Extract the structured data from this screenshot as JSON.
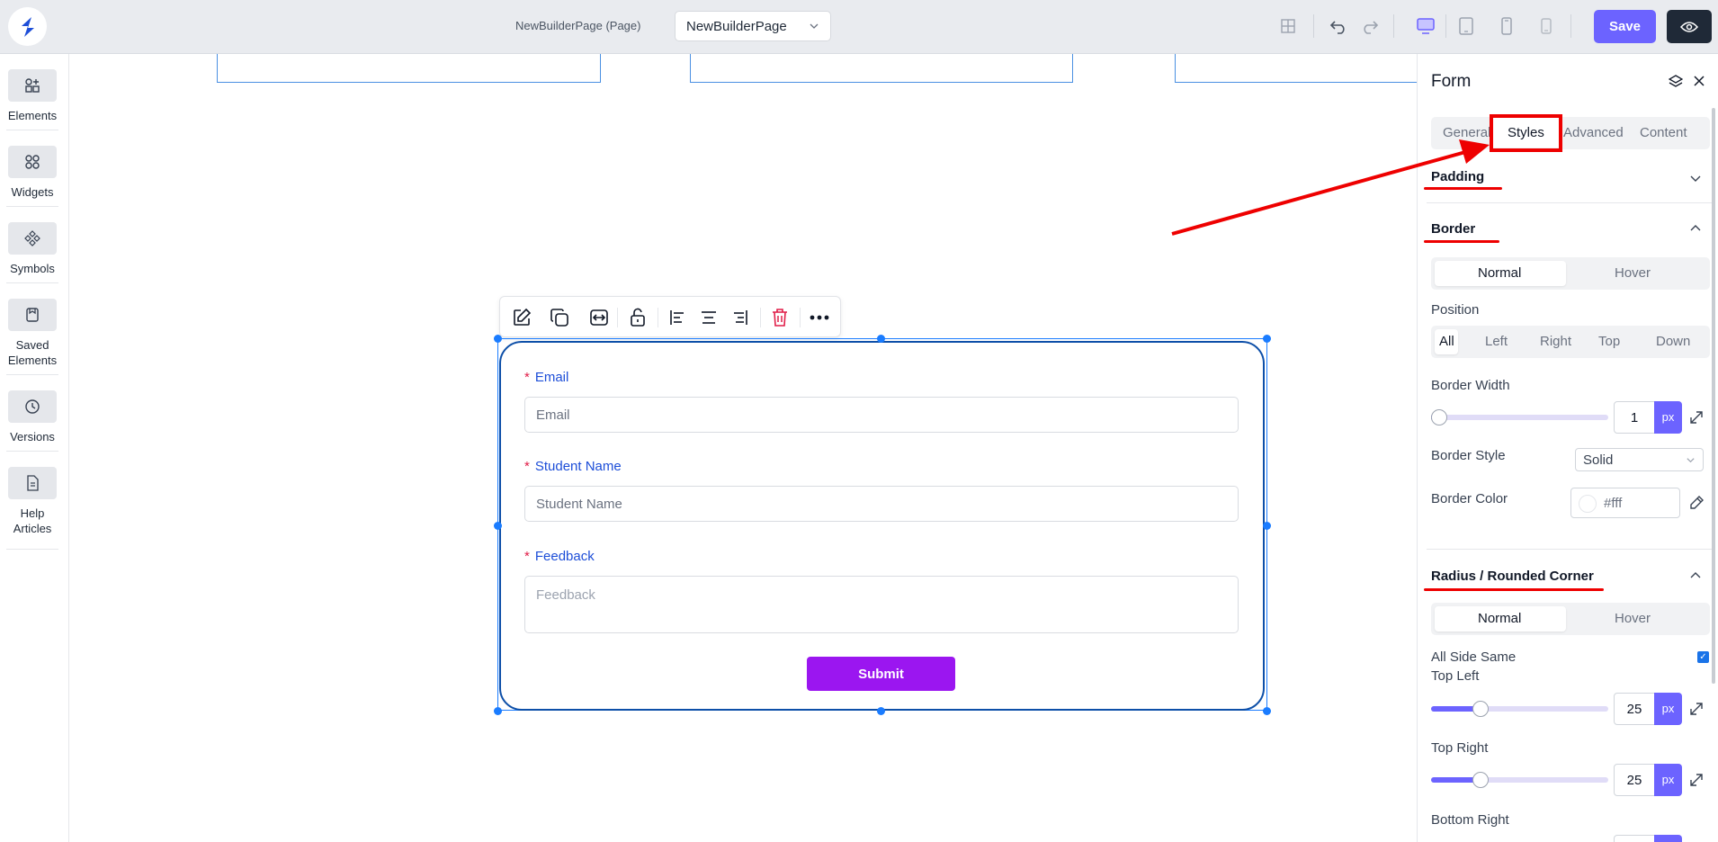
{
  "topbar": {
    "page_label": "NewBuilderPage (Page)",
    "page_select_value": "NewBuilderPage",
    "save_label": "Save"
  },
  "sidebar": {
    "items": [
      {
        "label": "Elements",
        "icon": "elements-icon"
      },
      {
        "label": "Widgets",
        "icon": "widgets-icon"
      },
      {
        "label": "Symbols",
        "icon": "symbols-icon"
      },
      {
        "label": "Saved Elements",
        "icon": "saved-elements-icon"
      },
      {
        "label": "Versions",
        "icon": "versions-icon"
      },
      {
        "label": "Help Articles",
        "icon": "help-articles-icon"
      }
    ]
  },
  "form": {
    "fields": [
      {
        "label": "Email",
        "placeholder": "Email",
        "required": "*"
      },
      {
        "label": "Student Name",
        "placeholder": "Student Name",
        "required": "*"
      },
      {
        "label": "Feedback",
        "placeholder": "Feedback",
        "required": "*"
      }
    ],
    "submit_label": "Submit"
  },
  "panel": {
    "title": "Form",
    "tabs": [
      "General",
      "Styles",
      "Advanced",
      "Content"
    ],
    "active_tab": "Styles",
    "padding_title": "Padding",
    "border_title": "Border",
    "border_state": {
      "normal": "Normal",
      "hover": "Hover"
    },
    "position_label": "Position",
    "positions": [
      "All",
      "Left",
      "Right",
      "Top",
      "Down"
    ],
    "border_width_label": "Border Width",
    "border_width_value": "1",
    "unit_px": "px",
    "border_style_label": "Border Style",
    "border_style_value": "Solid",
    "border_color_label": "Border Color",
    "border_color_value": "#fff",
    "radius_title": "Radius / Rounded Corner",
    "radius_state": {
      "normal": "Normal",
      "hover": "Hover"
    },
    "all_side_same_label": "All Side Same",
    "top_left_label": "Top Left",
    "top_left_value": "25",
    "top_right_label": "Top Right",
    "top_right_value": "25",
    "bottom_right_label": "Bottom Right"
  },
  "colors": {
    "accent": "#6c63ff",
    "submit": "#9b16f0",
    "annotation": "#ee0000",
    "selection": "#1a7cff"
  }
}
